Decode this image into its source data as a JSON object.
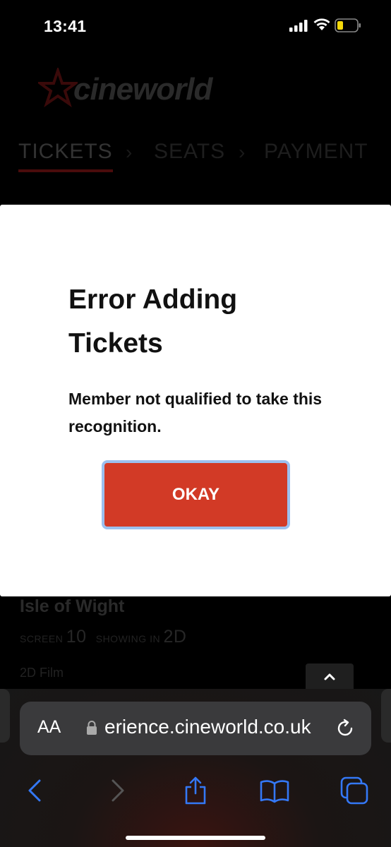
{
  "status_bar": {
    "time": "13:41"
  },
  "page": {
    "logo_text": "cineworld",
    "steps": [
      "TICKETS",
      "SEATS",
      "PAYMENT"
    ],
    "film_title": "Isle of Wight",
    "screen_label": "SCREEN",
    "screen_number": "10",
    "showing_label": "SHOWING IN",
    "showing_format": "2D",
    "film_type": "2D Film"
  },
  "modal": {
    "title": "Error Adding Tickets",
    "message": "Member not qualified to take this recognition.",
    "okay_label": "OKAY"
  },
  "safari": {
    "aa_label": "AA",
    "url": "erience.cineworld.co.uk"
  },
  "colors": {
    "button": "#d23a26",
    "focus_ring": "#9cc0ef",
    "toolbar_icon": "#3478f6"
  }
}
